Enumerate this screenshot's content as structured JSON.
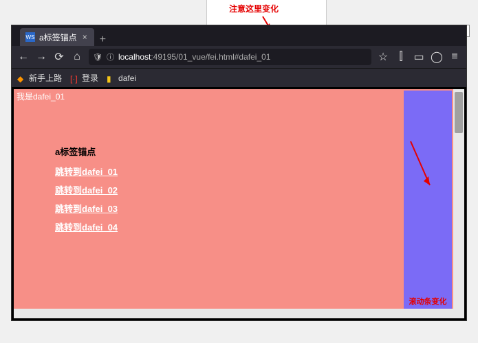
{
  "annotations": {
    "top": "注意这里变化",
    "side": "滚动条变化"
  },
  "window_controls": {
    "min": "—",
    "max": "▢",
    "close": "✕"
  },
  "tab": {
    "icon": "WS",
    "title": "a标签锚点",
    "close": "×",
    "new": "+"
  },
  "nav": {
    "back": "←",
    "forward": "→",
    "reload": "⟳",
    "home": "⌂",
    "shield": "🛡",
    "info": "ⓘ",
    "url_host": "localhost",
    "url_path": ":49195/01_vue/fei.html#dafei_01",
    "star": "☆",
    "book": "⫿",
    "reader": "▭",
    "account": "◯",
    "menu": "≡"
  },
  "bookmarks": [
    {
      "icon_color": "#ff9500",
      "label": "新手上路"
    },
    {
      "icon_color": "#ff3b30",
      "label": "登录"
    },
    {
      "icon_color": "#f5c518",
      "label": "dafei"
    }
  ],
  "page": {
    "header": "我是dafei_01",
    "anchor_title": "a标签锚点",
    "links": [
      "跳转到dafei_01",
      "跳转到dafei_02",
      "跳转到dafei_03",
      "跳转到dafei_04"
    ]
  }
}
